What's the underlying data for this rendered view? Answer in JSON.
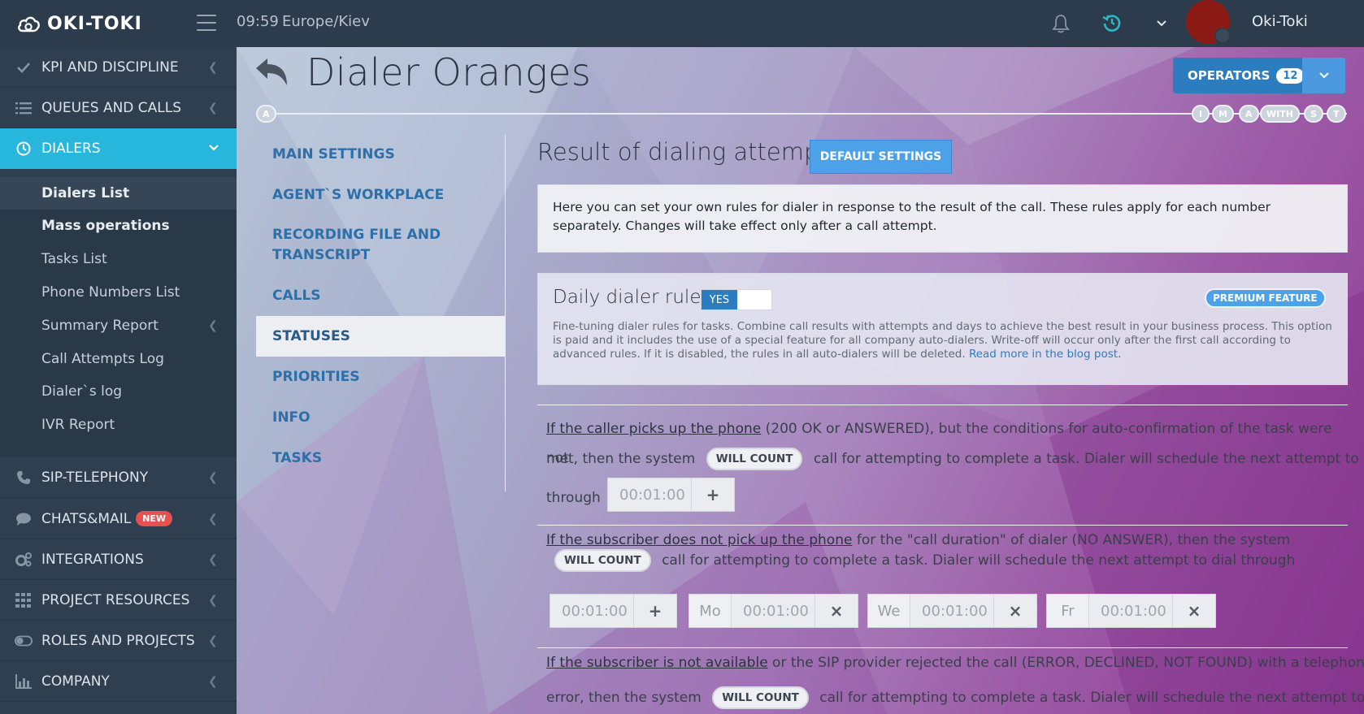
{
  "topbar": {
    "logo_text": "OKI-TOKI",
    "time": "09:59",
    "timezone": "Europe/Kiev",
    "username": "Oki-Toki"
  },
  "sidebar": {
    "items": [
      {
        "label": "KPI AND DISCIPLINE",
        "icon": "check-icon"
      },
      {
        "label": "QUEUES AND CALLS",
        "icon": "list-icon"
      },
      {
        "label": "DIALERS",
        "icon": "clock-icon",
        "active": true
      },
      {
        "label": "SIP-TELEPHONY",
        "icon": "phone-icon"
      },
      {
        "label": "CHATS&MAIL",
        "icon": "chat-icon",
        "badge": "NEW"
      },
      {
        "label": "INTEGRATIONS",
        "icon": "gears-icon"
      },
      {
        "label": "PROJECT RESOURCES",
        "icon": "grid-icon"
      },
      {
        "label": "ROLES AND PROJECTS",
        "icon": "toggle-icon"
      },
      {
        "label": "COMPANY",
        "icon": "bar-chart-icon"
      }
    ],
    "subitems": [
      {
        "label": "Dialers List"
      },
      {
        "label": "Mass operations"
      },
      {
        "label": "Tasks List"
      },
      {
        "label": "Phone Numbers List"
      },
      {
        "label": "Summary Report"
      },
      {
        "label": "Call Attempts Log"
      },
      {
        "label": "Dialer`s log"
      },
      {
        "label": "IVR Report"
      }
    ]
  },
  "page": {
    "title": "Dialer Oranges",
    "operators_label": "OPERATORS",
    "operators_count": "12",
    "timeline_start": "A",
    "timeline_tags": [
      "I",
      "M",
      "A",
      "WITH",
      "S",
      "T"
    ]
  },
  "settings_nav": [
    {
      "label": "MAIN SETTINGS"
    },
    {
      "label": "AGENT`S WORKPLACE"
    },
    {
      "label": "RECORDING FILE AND TRANSCRIPT"
    },
    {
      "label": "CALLS"
    },
    {
      "label": "STATUSES",
      "selected": true
    },
    {
      "label": "PRIORITIES"
    },
    {
      "label": "INFO"
    },
    {
      "label": "TASKS"
    }
  ],
  "content": {
    "section_title": "Result of dialing attempt",
    "default_button": "DEFAULT SETTINGS",
    "info_text": "Here you can set your own rules for dialer in response to the result of the call. These rules apply for each number separately. Changes will take effect only after a call attempt.",
    "daily_rules": {
      "title": "Daily dialer rules",
      "toggle_value": "YES",
      "premium_label": "PREMIUM FEATURE",
      "description": "Fine-tuning dialer rules for tasks. Combine call results with attempts and days to achieve the best result in your business process. This option is paid and it includes the use of a special feature for all company auto-dialers. Write-off will occur only after the first call according to advanced rules. If it is disabled, the rules in all auto-dialers will be deleted. ",
      "link": "Read more in the blog post",
      "link_tail": "."
    },
    "rule1": {
      "underlined": "If the caller picks up the phone",
      "text_a": " (200 OK or ANSWERED), but the conditions for auto-confirmation of the task were not",
      "text_b": "met, then the system",
      "pill": "WILL COUNT",
      "text_c": "call for attempting to complete a task. Dialer will schedule the next attempt to dial",
      "text_d": "through",
      "time": "00:01:00",
      "action": "+"
    },
    "rule2": {
      "underlined": "If the subscriber does not pick up the phone",
      "text_a": " for the \"call duration\" of dialer (NO ANSWER), then the system",
      "pill": "WILL COUNT",
      "text_c": "call for attempting to complete a task. Dialer will schedule the next attempt to dial through",
      "time": "00:01:00",
      "action": "+",
      "days": [
        {
          "day": "Mo",
          "time": "00:01:00",
          "action": "×"
        },
        {
          "day": "We",
          "time": "00:01:00",
          "action": "×"
        },
        {
          "day": "Fr",
          "time": "00:01:00",
          "action": "×"
        }
      ]
    },
    "rule3": {
      "underlined": "If the subscriber is not available",
      "text_a": " or the SIP provider rejected the call (ERROR, DECLINED, NOT FOUND) with a telephony",
      "text_b": "error, then the system",
      "pill": "WILL COUNT",
      "text_c": "call for attempting to complete a task. Dialer will schedule the next attempt to dial"
    }
  },
  "colors": {
    "topbar": "#2d3c4d",
    "sidebar": "#2f3f50",
    "active_item": "#27b7dc",
    "primary_button": "#2c7dc0",
    "link": "#2d6fa8"
  }
}
